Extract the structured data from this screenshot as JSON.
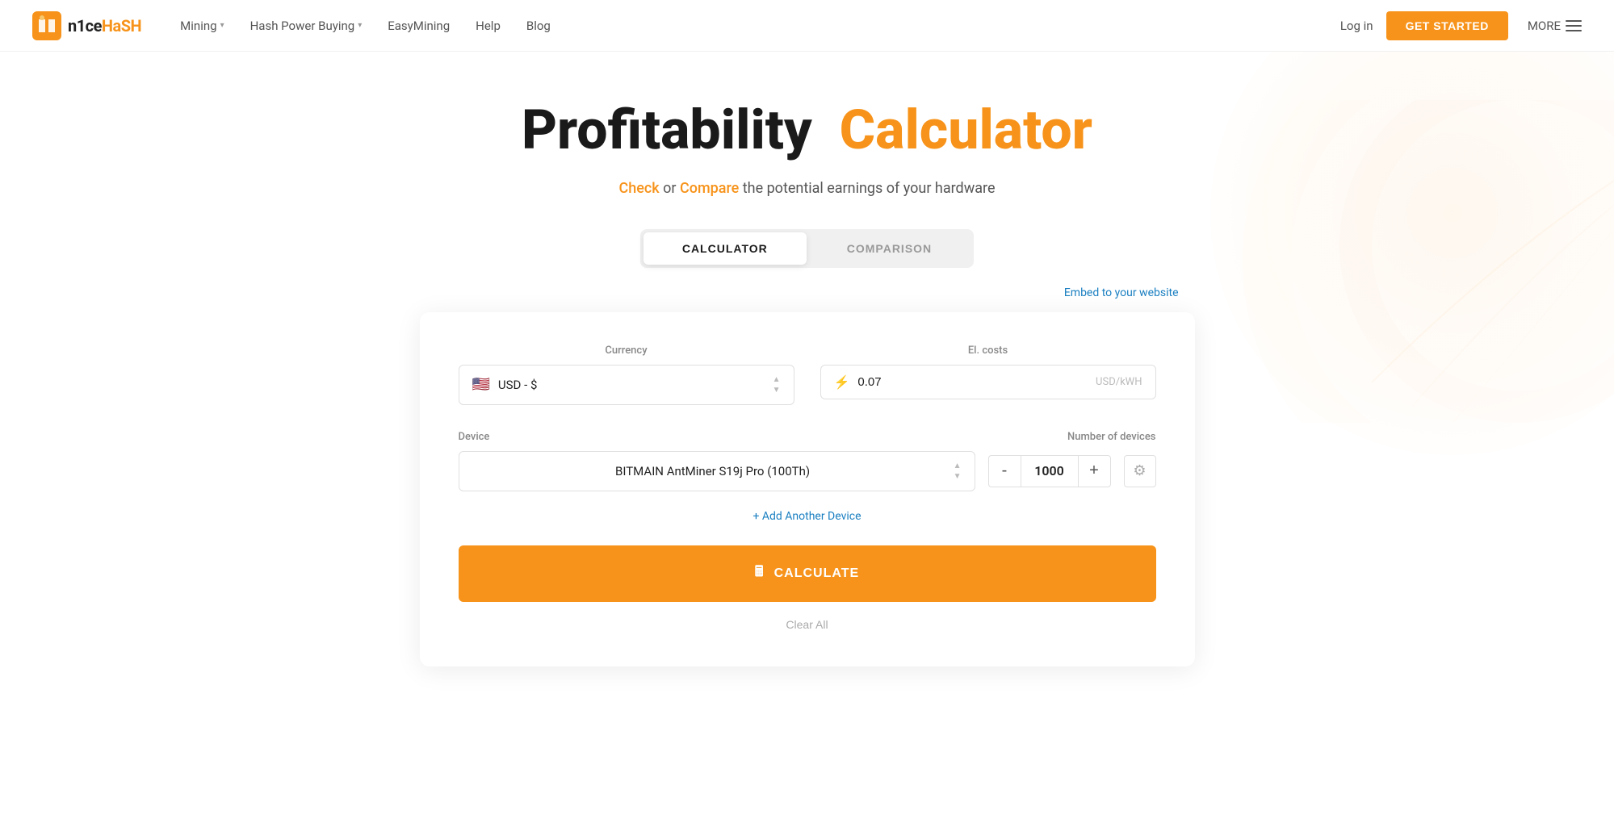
{
  "nav": {
    "logo_text_n": "n1ce",
    "logo_text_hash": "HaSH",
    "links": [
      {
        "label": "Mining",
        "has_dropdown": true
      },
      {
        "label": "Hash Power Buying",
        "has_dropdown": true
      },
      {
        "label": "EasyMining",
        "has_dropdown": false
      },
      {
        "label": "Help",
        "has_dropdown": false
      },
      {
        "label": "Blog",
        "has_dropdown": false
      }
    ],
    "login_label": "Log in",
    "get_started_label": "GET STARTED",
    "more_label": "MORE"
  },
  "hero": {
    "title_main": "Profitability",
    "title_orange": "Calculator",
    "subtitle_pre": " or ",
    "subtitle_check": "Check",
    "subtitle_compare": "Compare",
    "subtitle_post": " the potential earnings of your hardware"
  },
  "tabs": [
    {
      "id": "calculator",
      "label": "CALCULATOR",
      "active": true
    },
    {
      "id": "comparison",
      "label": "COMPARISON",
      "active": false
    }
  ],
  "embed_link": "Embed to your website",
  "form": {
    "currency_label": "Currency",
    "currency_value": "USD - $",
    "currency_flag": "🇺🇸",
    "el_costs_label": "El. costs",
    "el_costs_value": "0.07",
    "el_costs_unit": "USD/kWH",
    "device_label": "Device",
    "device_value": "BITMAIN AntMiner S19j Pro (100Th)",
    "num_devices_label": "Number of devices",
    "num_devices_value": "1000",
    "add_device_label": "+ Add Another Device",
    "calculate_label": "CALCULATE",
    "clear_all_label": "Clear All",
    "minus_label": "-",
    "plus_label": "+"
  },
  "colors": {
    "orange": "#f7931a",
    "blue_link": "#1a7fc1",
    "text_dark": "#1a1a1a",
    "text_muted": "#888",
    "border": "#e0e0e0"
  }
}
